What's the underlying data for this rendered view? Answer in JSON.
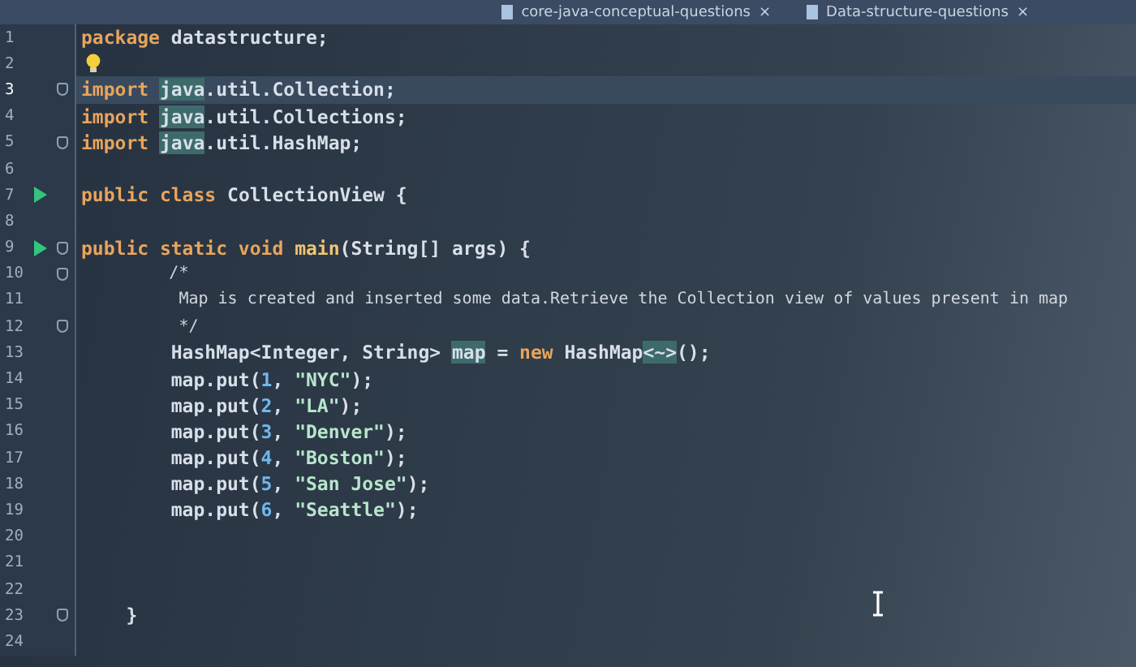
{
  "tabs": [
    {
      "label": "core-java-conceptual-questions",
      "close": "×",
      "selected": false
    },
    {
      "label": "Data-structure-questions",
      "close": "×",
      "selected": false
    }
  ],
  "lines": [
    {
      "number": "1",
      "current": false,
      "run": false,
      "fold": false,
      "bulb": false,
      "tokens": [
        {
          "kind": "kw",
          "text": "package "
        },
        {
          "kind": "id",
          "text": "datastructure;"
        }
      ]
    },
    {
      "number": "2",
      "current": false,
      "run": false,
      "fold": false,
      "bulb": true
    },
    {
      "number": "3",
      "current": true,
      "run": false,
      "fold": true,
      "bulb": false,
      "tokens": [
        {
          "kind": "kw",
          "text": "import "
        },
        {
          "kind": "hl",
          "text": "java"
        },
        {
          "kind": "id",
          "text": ".util.Collection;"
        }
      ]
    },
    {
      "number": "4",
      "current": false,
      "run": false,
      "fold": false,
      "bulb": false,
      "tokens": [
        {
          "kind": "kw",
          "text": "import "
        },
        {
          "kind": "hl",
          "text": "java"
        },
        {
          "kind": "id",
          "text": ".util.Collections;"
        }
      ]
    },
    {
      "number": "5",
      "current": false,
      "run": false,
      "fold": true,
      "bulb": false,
      "tokens": [
        {
          "kind": "kw",
          "text": "import "
        },
        {
          "kind": "hl",
          "text": "java"
        },
        {
          "kind": "id",
          "text": ".util.HashMap;"
        }
      ]
    },
    {
      "number": "6",
      "current": false,
      "run": false,
      "fold": false,
      "bulb": false
    },
    {
      "number": "7",
      "current": false,
      "run": true,
      "fold": false,
      "bulb": false,
      "tokens": [
        {
          "kind": "kw",
          "text": "public class "
        },
        {
          "kind": "id",
          "text": "CollectionView {"
        }
      ]
    },
    {
      "number": "8",
      "current": false,
      "run": false,
      "fold": false,
      "bulb": false
    },
    {
      "number": "9",
      "current": false,
      "run": true,
      "fold": true,
      "bulb": false,
      "tokens": [
        {
          "kind": "kw",
          "text": "public static void "
        },
        {
          "kind": "fn",
          "text": "main"
        },
        {
          "kind": "id",
          "text": "(String[] args) {"
        }
      ]
    },
    {
      "number": "10",
      "current": false,
      "run": false,
      "fold": true,
      "bulb": false,
      "tokens": [
        {
          "kind": "cmt",
          "text": "         /*"
        }
      ]
    },
    {
      "number": "11",
      "current": false,
      "run": false,
      "fold": false,
      "bulb": false,
      "tokens": [
        {
          "kind": "cmt",
          "text": "          Map is created and inserted some data.Retrieve the Collection view of values present in map"
        }
      ]
    },
    {
      "number": "12",
      "current": false,
      "run": false,
      "fold": true,
      "bulb": false,
      "tokens": [
        {
          "kind": "cmt",
          "text": "          */"
        }
      ]
    },
    {
      "number": "13",
      "current": false,
      "run": false,
      "fold": false,
      "bulb": false,
      "tokens": [
        {
          "kind": "id",
          "text": "        HashMap<Integer, String> "
        },
        {
          "kind": "hl",
          "text": "map"
        },
        {
          "kind": "id",
          "text": " = "
        },
        {
          "kind": "kw",
          "text": "new "
        },
        {
          "kind": "id",
          "text": "HashMap"
        },
        {
          "kind": "hl",
          "text": "<~>"
        },
        {
          "kind": "id",
          "text": "();"
        }
      ]
    },
    {
      "number": "14",
      "current": false,
      "run": false,
      "fold": false,
      "bulb": false,
      "tokens": [
        {
          "kind": "id",
          "text": "        map.put("
        },
        {
          "kind": "num",
          "text": "1"
        },
        {
          "kind": "id",
          "text": ", "
        },
        {
          "kind": "str",
          "text": "\"NYC\""
        },
        {
          "kind": "id",
          "text": ");"
        }
      ]
    },
    {
      "number": "15",
      "current": false,
      "run": false,
      "fold": false,
      "bulb": false,
      "tokens": [
        {
          "kind": "id",
          "text": "        map.put("
        },
        {
          "kind": "num",
          "text": "2"
        },
        {
          "kind": "id",
          "text": ", "
        },
        {
          "kind": "str",
          "text": "\"LA\""
        },
        {
          "kind": "id",
          "text": ");"
        }
      ]
    },
    {
      "number": "16",
      "current": false,
      "run": false,
      "fold": false,
      "bulb": false,
      "tokens": [
        {
          "kind": "id",
          "text": "        map.put("
        },
        {
          "kind": "num",
          "text": "3"
        },
        {
          "kind": "id",
          "text": ", "
        },
        {
          "kind": "str",
          "text": "\"Denver\""
        },
        {
          "kind": "id",
          "text": ");"
        }
      ]
    },
    {
      "number": "17",
      "current": false,
      "run": false,
      "fold": false,
      "bulb": false,
      "tokens": [
        {
          "kind": "id",
          "text": "        map.put("
        },
        {
          "kind": "num",
          "text": "4"
        },
        {
          "kind": "id",
          "text": ", "
        },
        {
          "kind": "str",
          "text": "\"Boston\""
        },
        {
          "kind": "id",
          "text": ");"
        }
      ]
    },
    {
      "number": "18",
      "current": false,
      "run": false,
      "fold": false,
      "bulb": false,
      "tokens": [
        {
          "kind": "id",
          "text": "        map.put("
        },
        {
          "kind": "num",
          "text": "5"
        },
        {
          "kind": "id",
          "text": ", "
        },
        {
          "kind": "str",
          "text": "\"San Jose\""
        },
        {
          "kind": "id",
          "text": ");"
        }
      ]
    },
    {
      "number": "19",
      "current": false,
      "run": false,
      "fold": false,
      "bulb": false,
      "tokens": [
        {
          "kind": "id",
          "text": "        map.put("
        },
        {
          "kind": "num",
          "text": "6"
        },
        {
          "kind": "id",
          "text": ", "
        },
        {
          "kind": "str",
          "text": "\"Seattle\""
        },
        {
          "kind": "id",
          "text": ");"
        }
      ]
    },
    {
      "number": "20",
      "current": false,
      "run": false,
      "fold": false,
      "bulb": false
    },
    {
      "number": "21",
      "current": false,
      "run": false,
      "fold": false,
      "bulb": false
    },
    {
      "number": "22",
      "current": false,
      "run": false,
      "fold": false,
      "bulb": false
    },
    {
      "number": "23",
      "current": false,
      "run": false,
      "fold": true,
      "bulb": false,
      "tokens": [
        {
          "kind": "id",
          "text": "    }"
        }
      ]
    },
    {
      "number": "24",
      "current": false,
      "run": false,
      "fold": false,
      "bulb": false
    }
  ]
}
